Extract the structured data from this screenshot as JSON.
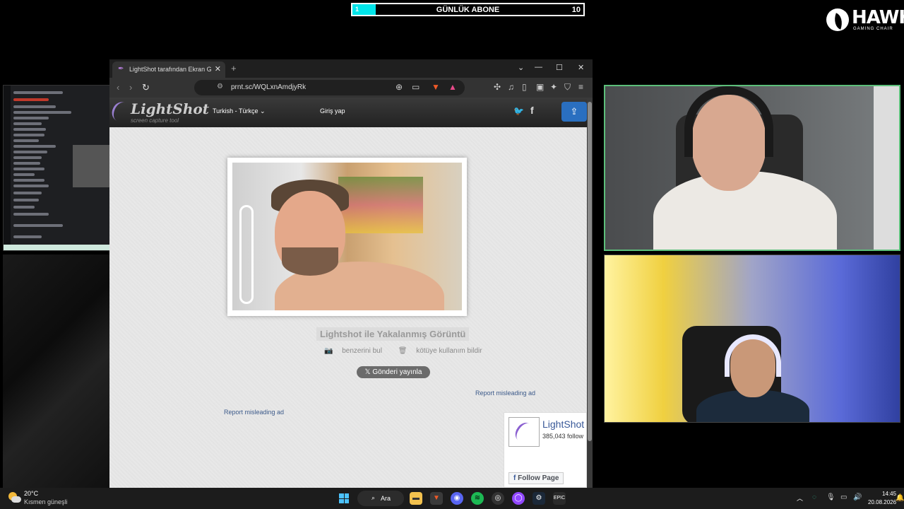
{
  "overlay": {
    "sub_bar": {
      "left_value": "1",
      "title": "GÜNLÜK ABONE",
      "right_value": "10",
      "progress": 0.1,
      "fill_color": "#00e5ea"
    },
    "logo": {
      "name": "HAWK",
      "subtitle": "GAMING CHAIR"
    }
  },
  "browser": {
    "tab_title": "LightShot tarafından Ekran Görüntüsü",
    "new_tab": "+",
    "window_controls": {
      "dropdown": "⌄",
      "minimize": "—",
      "maximize": "☐",
      "close": "✕"
    },
    "url": "prnt.sc/WQLxnAmdjyRk"
  },
  "lightshot": {
    "logo_name": "LightShot",
    "logo_tagline": "screen capture tool",
    "language": "Turkish - Türkçe",
    "login": "Giriş yap",
    "caption": "Lightshot ile Yakalanmış Görüntü",
    "find_similar": "benzerini bul",
    "report_abuse": "kötüye kullanım bildir",
    "tweet_button": "Gönderi yayınla",
    "ad_report_1": "Report misleading ad",
    "ad_report_2": "Report misleading ad",
    "fb_widget": {
      "name": "LightShot",
      "followers": "385,043 follow",
      "follow_button": "Follow Page"
    },
    "accent_color": "#2a6fc0"
  },
  "taskbar": {
    "temperature": "20°C",
    "condition": "Kısmen güneşli",
    "search_label": "Ara",
    "time": "14:45",
    "date": "20.08.2026"
  }
}
